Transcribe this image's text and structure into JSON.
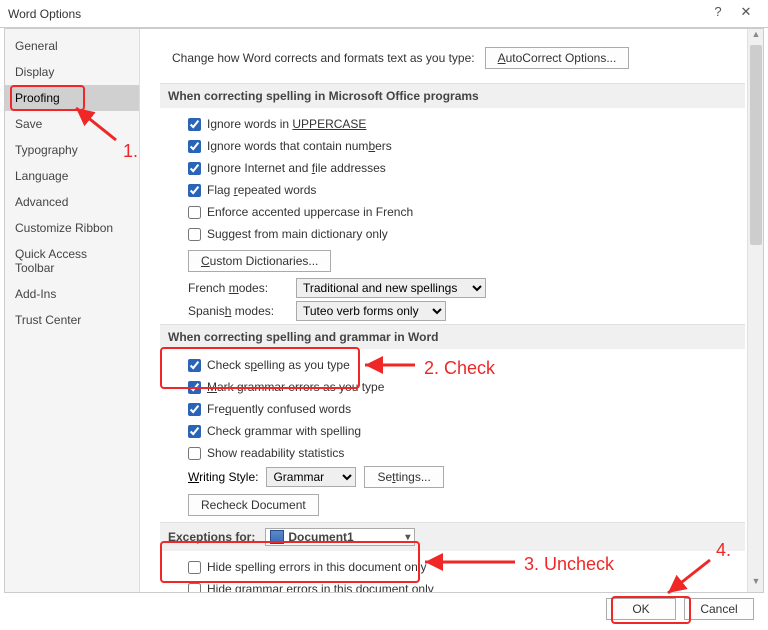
{
  "window": {
    "title": "Word Options"
  },
  "sidebar": {
    "items": [
      {
        "label": "General"
      },
      {
        "label": "Display"
      },
      {
        "label": "Proofing",
        "selected": true
      },
      {
        "label": "Save"
      },
      {
        "label": "Typography"
      },
      {
        "label": "Language"
      },
      {
        "label": "Advanced"
      },
      {
        "label": "Customize Ribbon"
      },
      {
        "label": "Quick Access Toolbar"
      },
      {
        "label": "Add-Ins"
      },
      {
        "label": "Trust Center"
      }
    ]
  },
  "intro": {
    "text": "Change how Word corrects and formats text as you type:",
    "button": "AutoCorrect Options..."
  },
  "sectionA": {
    "header": "When correcting spelling in Microsoft Office programs",
    "opts": {
      "uppercase_pre": "Ignore words in ",
      "uppercase_u": "UPPERCASE",
      "numbers_pre": "Ignore words that contain num",
      "numbers_u": "b",
      "numbers_post": "ers",
      "internet_pre": "Ignore Internet and ",
      "internet_u": "f",
      "internet_post": "ile addresses",
      "repeated_pre": "Flag ",
      "repeated_u": "r",
      "repeated_post": "epeated words",
      "accented": "Enforce accented uppercase in French",
      "mainDict": "Suggest from main dictionary only"
    },
    "customDict_u": "C",
    "customDict_post": "ustom Dictionaries...",
    "frenchLabel_pre": "French ",
    "frenchLabel_u": "m",
    "frenchLabel_post": "odes:",
    "frenchValue": "Traditional and new spellings",
    "spanishLabel_pre": "Spanis",
    "spanishLabel_u": "h",
    "spanishLabel_post": " modes:",
    "spanishValue": "Tuteo verb forms only"
  },
  "sectionB": {
    "header": "When correcting spelling and grammar in Word",
    "opts": {
      "spelling_pre": "Check s",
      "spelling_u": "p",
      "spelling_post": "elling as you type",
      "grammar_pre": "",
      "grammar_u": "M",
      "grammar_post": "ark grammar errors as you type",
      "confused_pre": "Fre",
      "confused_u": "q",
      "confused_post": "uently confused words",
      "checkGrammar": "Check grammar with spelling",
      "readability": "Show readability statistics"
    },
    "styleLabel_u": "W",
    "styleLabel_post": "riting Style:",
    "styleValue": "Grammar",
    "settingsBtn_pre": "Se",
    "settingsBtn_u": "t",
    "settingsBtn_post": "tings...",
    "recheckBtn": "Recheck Document"
  },
  "sectionC": {
    "header_pre": "Exceptions for:",
    "doc": "Document1",
    "hideSpelling": "Hide spelling errors in this document only",
    "hideGrammar": "Hide grammar errors in this document only"
  },
  "footer": {
    "ok": "OK",
    "cancel": "Cancel"
  },
  "annotations": {
    "step1": "1.",
    "step2": "2. Check",
    "step3": "3. Uncheck",
    "step4": "4."
  }
}
